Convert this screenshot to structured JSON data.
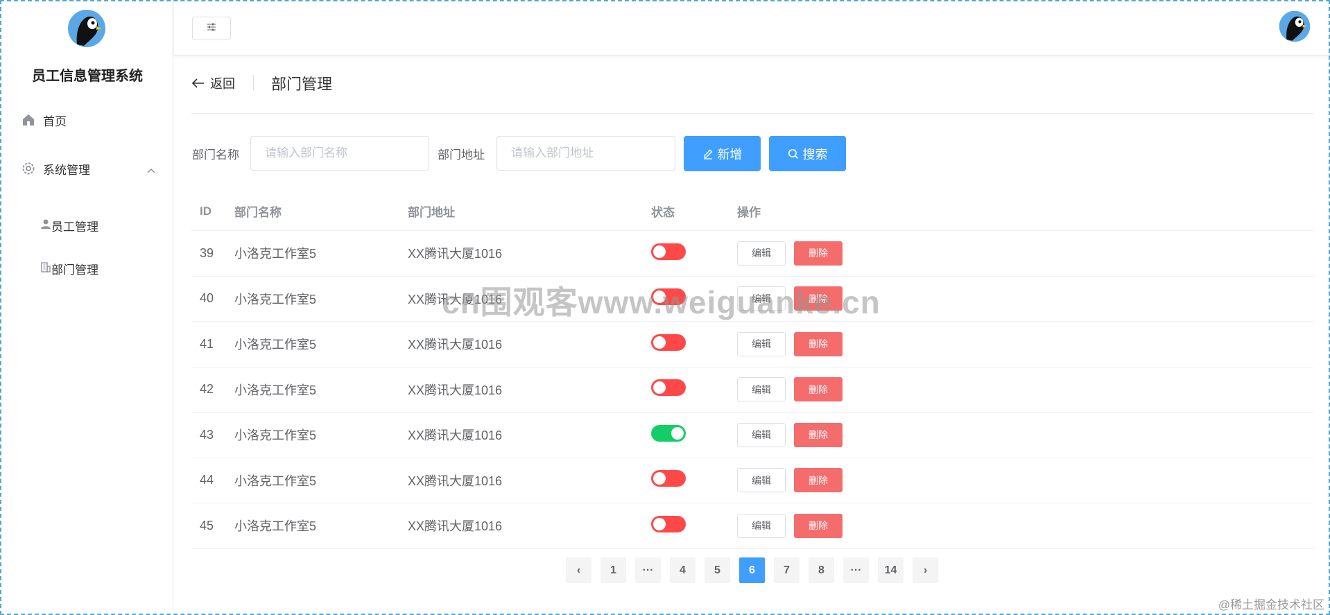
{
  "app": {
    "title": "员工信息管理系统"
  },
  "sidebar": {
    "home": "首页",
    "system": "系统管理",
    "employee": "员工管理",
    "department": "部门管理"
  },
  "page_header": {
    "back": "返回",
    "title": "部门管理"
  },
  "search": {
    "name_label": "部门名称",
    "name_placeholder": "请输入部门名称",
    "addr_label": "部门地址",
    "addr_placeholder": "请输入部门地址",
    "add_button": "新增",
    "search_button": "搜索"
  },
  "table": {
    "headers": {
      "id": "ID",
      "name": "部门名称",
      "addr": "部门地址",
      "status": "状态",
      "ops": "操作"
    },
    "edit_label": "编辑",
    "delete_label": "删除",
    "rows": [
      {
        "id": "39",
        "name": "小洛克工作室5",
        "addr": "XX腾讯大厦1016",
        "status": "off"
      },
      {
        "id": "40",
        "name": "小洛克工作室5",
        "addr": "XX腾讯大厦1016",
        "status": "off"
      },
      {
        "id": "41",
        "name": "小洛克工作室5",
        "addr": "XX腾讯大厦1016",
        "status": "off"
      },
      {
        "id": "42",
        "name": "小洛克工作室5",
        "addr": "XX腾讯大厦1016",
        "status": "off"
      },
      {
        "id": "43",
        "name": "小洛克工作室5",
        "addr": "XX腾讯大厦1016",
        "status": "on"
      },
      {
        "id": "44",
        "name": "小洛克工作室5",
        "addr": "XX腾讯大厦1016",
        "status": "off"
      },
      {
        "id": "45",
        "name": "小洛克工作室5",
        "addr": "XX腾讯大厦1016",
        "status": "off"
      }
    ]
  },
  "pagination": {
    "prev": "‹",
    "next": "›",
    "pages": [
      "1",
      "···",
      "4",
      "5",
      "6",
      "7",
      "8",
      "···",
      "14"
    ],
    "current": "6"
  },
  "watermark": "cn围观客www.weiguanke.cn",
  "footer_mark": "@稀土掘金技术社区",
  "colors": {
    "primary": "#409eff",
    "danger": "#f56c6c",
    "switch_off": "#ff4949",
    "switch_on": "#13ce66"
  },
  "icons": {
    "home": "home-icon",
    "system": "gear-icon",
    "employee": "user-icon",
    "department": "building-icon"
  }
}
